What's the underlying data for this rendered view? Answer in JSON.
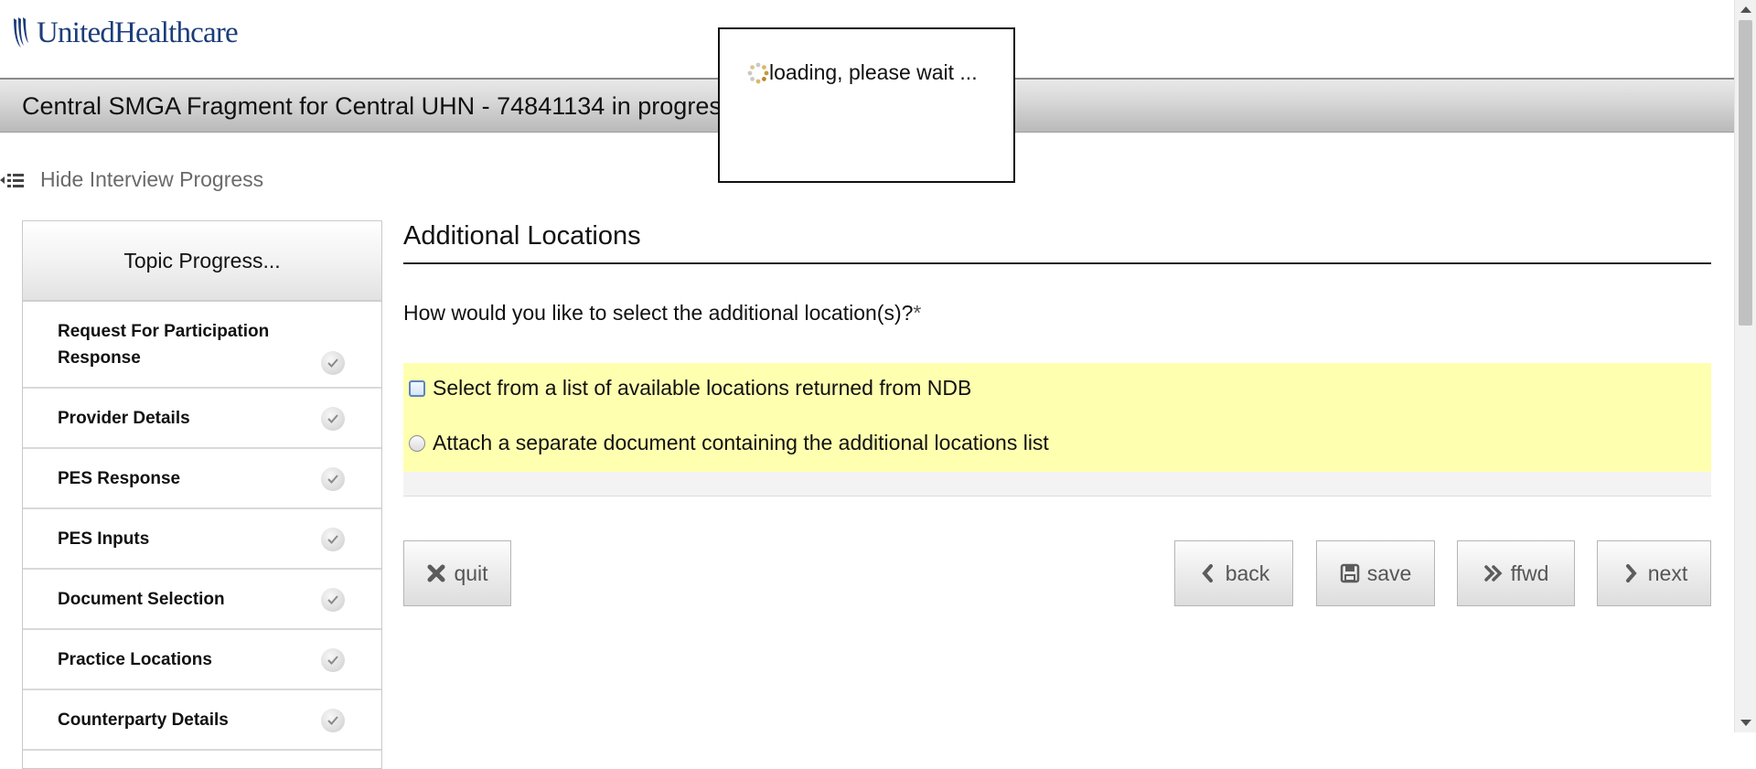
{
  "header": {
    "logo_text": "UnitedHealthcare",
    "brand_color": "#1b3d7a"
  },
  "title_bar": {
    "title": "Central SMGA Fragment for Central UHN - 74841134 in progress"
  },
  "sidebar_toggle": {
    "label": "Hide Interview Progress",
    "icon": "collapse-list-icon"
  },
  "topic_panel": {
    "header": "Topic Progress...",
    "items": [
      {
        "label": "Request For Participation Response",
        "status": "complete",
        "icon": "check-icon"
      },
      {
        "label": "Provider Details",
        "status": "complete",
        "icon": "check-icon"
      },
      {
        "label": "PES Response",
        "status": "complete",
        "icon": "check-icon"
      },
      {
        "label": "PES Inputs",
        "status": "complete",
        "icon": "check-icon"
      },
      {
        "label": "Document Selection",
        "status": "complete",
        "icon": "check-icon"
      },
      {
        "label": "Practice Locations",
        "status": "complete",
        "icon": "check-icon"
      },
      {
        "label": "Counterparty Details",
        "status": "complete",
        "icon": "check-icon"
      }
    ]
  },
  "main": {
    "title": "Additional Locations",
    "question": "How would you like to select the additional location(s)?",
    "required_marker": "*",
    "options": [
      {
        "label": "Select from a list of available locations returned from NDB",
        "control": "checkbox",
        "checked": false
      },
      {
        "label": "Attach a separate document containing the additional locations list",
        "control": "radio",
        "checked": false
      }
    ],
    "highlight_color": "#ffffb0"
  },
  "buttons": {
    "quit": {
      "label": "quit",
      "icon": "close-icon"
    },
    "back": {
      "label": "back",
      "icon": "chevron-left-icon"
    },
    "save": {
      "label": "save",
      "icon": "floppy-disk-icon"
    },
    "ffwd": {
      "label": "ffwd",
      "icon": "double-chevron-right-icon"
    },
    "next": {
      "label": "next",
      "icon": "chevron-right-icon"
    }
  },
  "loading_dialog": {
    "message": "loading, please wait ...",
    "icon": "spinner-icon"
  }
}
